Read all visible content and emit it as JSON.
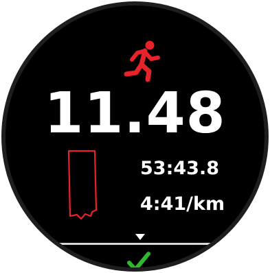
{
  "activity": {
    "icon": "running-icon",
    "accent_color": "#e8222b"
  },
  "metrics": {
    "distance": "11.48",
    "elapsed_time": "53:43.8",
    "pace": "4:41/km"
  },
  "navigation": {
    "more_icon": "chevron-down-icon",
    "confirm_icon": "checkmark-icon",
    "confirm_color": "#2eb82e"
  }
}
